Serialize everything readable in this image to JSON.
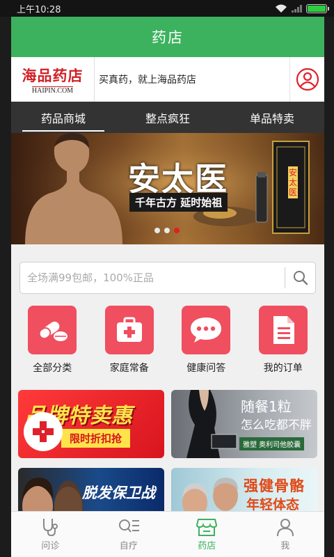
{
  "status": {
    "time": "上午10:28"
  },
  "header": {
    "title": "药店"
  },
  "brand": {
    "logo_cn": "海品药店",
    "logo_en": "HAIPIN.COM",
    "slogan": "买真药，就上海品药店"
  },
  "tabs": [
    {
      "label": "药品商城",
      "active": true
    },
    {
      "label": "整点疯狂",
      "active": false
    },
    {
      "label": "单品特卖",
      "active": false
    }
  ],
  "banner": {
    "title": "安太医",
    "subtitle": "千年古方 延时始祖",
    "product_label": "安太医",
    "slides": 3,
    "active_slide": 3
  },
  "search": {
    "placeholder": "全场满99包邮，100%正品"
  },
  "quick": [
    {
      "label": "全部分类",
      "icon": "pills-icon"
    },
    {
      "label": "家庭常备",
      "icon": "first-aid-kit-icon"
    },
    {
      "label": "健康问答",
      "icon": "chat-bubble-icon"
    },
    {
      "label": "我的订单",
      "icon": "document-icon"
    }
  ],
  "promos": [
    {
      "title": "品牌特卖惠",
      "tag": "限时折扣抢"
    },
    {
      "line1": "随餐1粒",
      "line2": "怎么吃都不胖",
      "caption": "雅塑 奥利司他胶囊"
    },
    {
      "title": "脱发保卫战"
    },
    {
      "line1": "强健骨骼",
      "line2": "年轻体态"
    }
  ],
  "bottom_nav": [
    {
      "label": "问诊",
      "icon": "stethoscope-icon",
      "active": false
    },
    {
      "label": "自疗",
      "icon": "search-list-icon",
      "active": false
    },
    {
      "label": "药店",
      "icon": "store-icon",
      "active": true
    },
    {
      "label": "我",
      "icon": "person-icon",
      "active": false
    }
  ],
  "colors": {
    "primary_green": "#3cb25e",
    "accent_red": "#ef4f5f",
    "tab_bg": "#333334"
  }
}
